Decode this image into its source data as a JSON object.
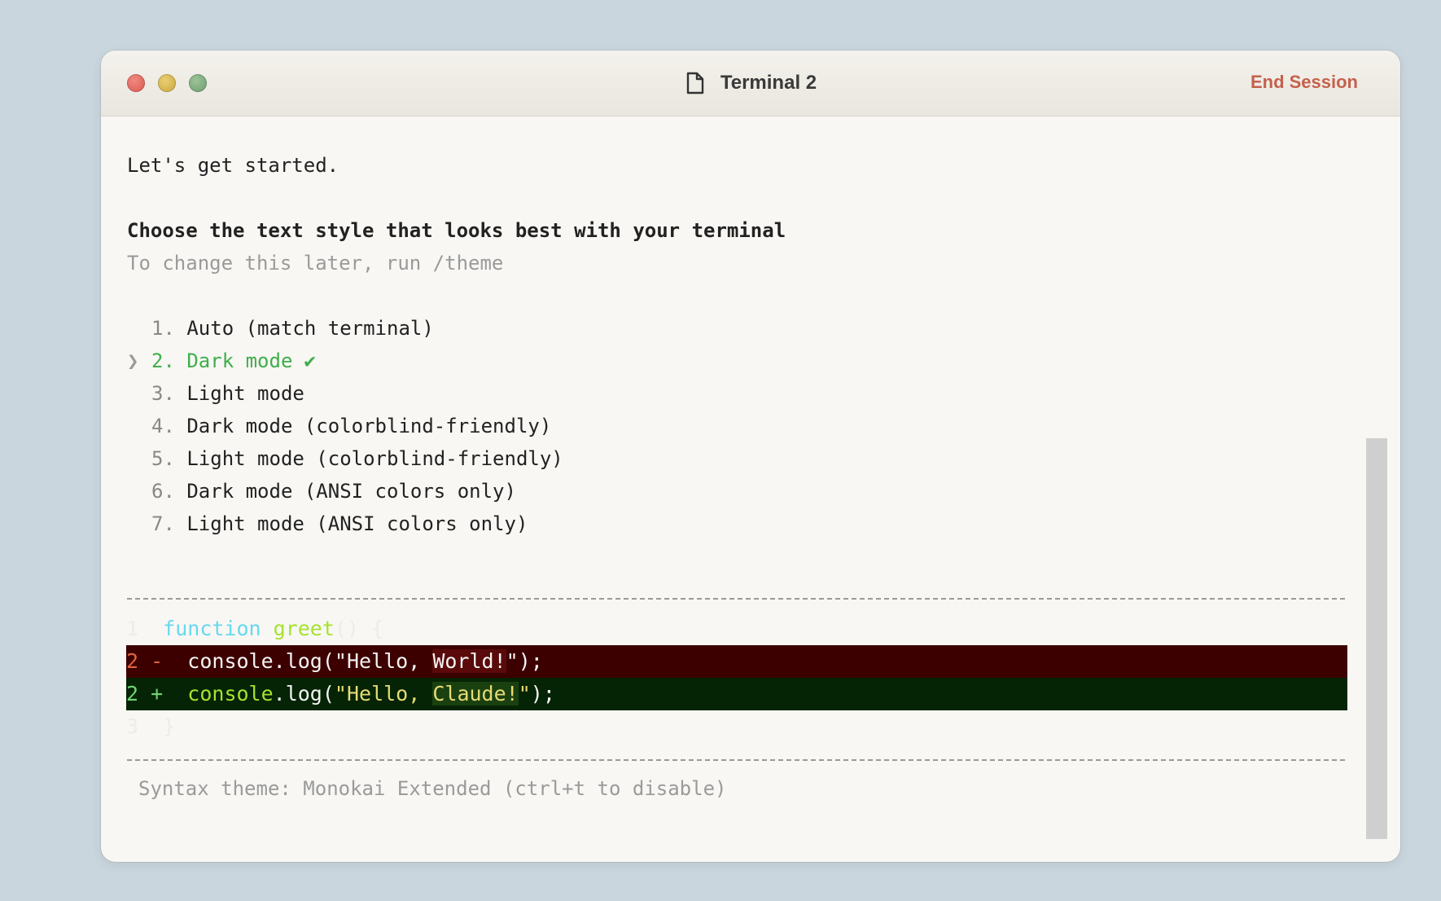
{
  "window": {
    "title": "Terminal 2",
    "end_session_label": "End Session"
  },
  "intro": "Let's get started.",
  "heading": "Choose the text style that looks best with your terminal",
  "subheading": "To change this later, run /theme",
  "options": [
    {
      "num": "1.",
      "label": "Auto (match terminal)"
    },
    {
      "num": "2.",
      "label": "Dark mode",
      "selected": true
    },
    {
      "num": "3.",
      "label": "Light mode"
    },
    {
      "num": "4.",
      "label": "Dark mode (colorblind-friendly)"
    },
    {
      "num": "5.",
      "label": "Light mode (colorblind-friendly)"
    },
    {
      "num": "6.",
      "label": "Dark mode (ANSI colors only)"
    },
    {
      "num": "7.",
      "label": "Light mode (ANSI colors only)"
    }
  ],
  "cursor_glyph": "❯",
  "check_glyph": "✔",
  "diff": {
    "line1": {
      "num": "1",
      "kw": "function",
      "fn": "greet",
      "rest": "() {"
    },
    "line2_del": {
      "num": "2",
      "sign": "-",
      "pre": "  console.log(\"Hello, ",
      "changed": "World!",
      "post": "\");"
    },
    "line2_add": {
      "num": "2",
      "sign": "+",
      "pre_fn": "  console",
      "pre": ".log(",
      "str_pre": "\"Hello, ",
      "changed": "Claude!",
      "str_post": "\"",
      "post": ");"
    },
    "line3": {
      "num": "3",
      "rest": "}"
    }
  },
  "footer": "Syntax theme: Monokai Extended (ctrl+t to disable)",
  "colors": {
    "selected": "#3fae4b",
    "end_session": "#c4614c",
    "diff_del_bg": "#3d0000",
    "diff_add_bg": "#052405"
  }
}
